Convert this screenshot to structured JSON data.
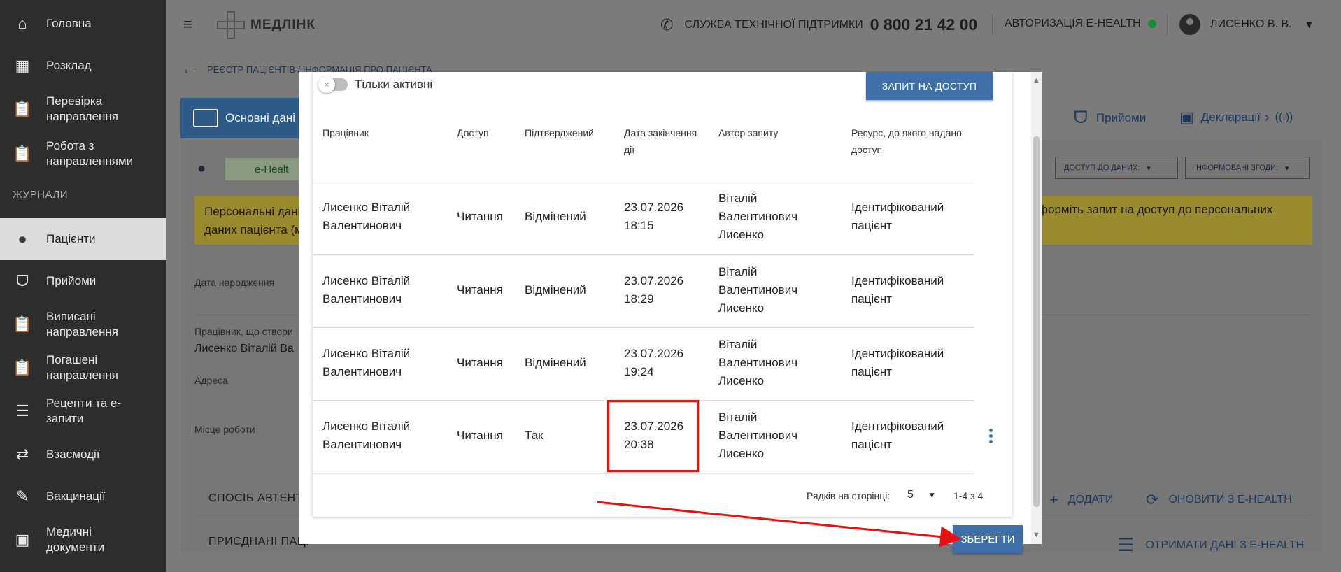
{
  "sidebar": {
    "items": [
      {
        "label": "Головна",
        "icon": "home-icon"
      },
      {
        "label": "Розклад",
        "icon": "calendar-icon"
      },
      {
        "label": "Перевірка направлення",
        "icon": "clipboard-icon"
      },
      {
        "label": "Робота з направленнями",
        "icon": "clipboard-icon"
      },
      {
        "label": "Пацієнти",
        "icon": "person-icon"
      },
      {
        "label": "Прийоми",
        "icon": "stethoscope-icon"
      },
      {
        "label": "Виписані направлення",
        "icon": "clipboard-icon"
      },
      {
        "label": "Погашені направлення",
        "icon": "clipboard-icon"
      },
      {
        "label": "Рецепти та е-запити",
        "icon": "list-icon"
      },
      {
        "label": "Взаємодії",
        "icon": "swap-icon"
      },
      {
        "label": "Вакцинації",
        "icon": "syringe-icon"
      },
      {
        "label": "Медичні документи",
        "icon": "document-plus-icon"
      }
    ],
    "section_label": "ЖУРНАЛИ",
    "active_item": "Пацієнти"
  },
  "header": {
    "logo_text": "МЕДЛІНК",
    "support_label": "СЛУЖБА ТЕХНІЧНОЇ ПІДТРИМКИ",
    "support_phone": "0 800 21 42 00",
    "ehealth_label": "АВТОРИЗАЦІЯ E-HEALTH",
    "ehealth_status_color": "#1b8a3a",
    "user_name": "ЛИСЕНКО В. В."
  },
  "page": {
    "breadcrumb": "РЕЄСТР ПАЦІЄНТІВ / ІНФОРМАЦІЯ ПРО ПАЦІЄНТА",
    "tab_main": "Основні дані",
    "tab_visits": "Прийоми",
    "tab_declarations": "Декларації",
    "ehealth_chip": "e-Healt",
    "dropdown_access": "ДОСТУП ДО ДАНИХ:",
    "dropdown_consents": "ІНФОРМОВАНІ ЗГОДИ:",
    "warning_left": "Персональні дані",
    "warning_left2": "даних пацієнта (м",
    "warning_right": "форміть запит на доступ до персональних",
    "label_birth": "Дата народження",
    "label_creator": "Працівник, що створи",
    "value_creator": "Лисенко Віталій Ва",
    "label_address": "Адреса",
    "label_work": "Місце роботи",
    "section_auth": "СПОСІБ АВТЕНТИ",
    "section_linked": "ПРИЄДНАНІ ПАЦІ",
    "action_add": "ДОДАТИ",
    "action_refresh": "ОНОВИТИ З E-HEALTH",
    "action_get": "ОТРИМАТИ ДАНІ З E-HEALTH"
  },
  "modal": {
    "toggle_label": "Тільки активні",
    "request_button": "ЗАПИТ НА ДОСТУП",
    "columns": [
      "Працівник",
      "Доступ",
      "Підтверджений",
      "Дата закінчення дії",
      "Автор запиту",
      "Ресурс, до якого надано доступ"
    ],
    "rows": [
      {
        "worker": "Лисенко Віталій Валентинович",
        "access": "Читання",
        "confirmed": "Відмінений",
        "date": "23.07.2026",
        "time": "18:15",
        "author": "Віталій Валентинович Лисенко",
        "resource": "Ідентифікований пацієнт"
      },
      {
        "worker": "Лисенко Віталій Валентинович",
        "access": "Читання",
        "confirmed": "Відмінений",
        "date": "23.07.2026",
        "time": "18:29",
        "author": "Віталій Валентинович Лисенко",
        "resource": "Ідентифікований пацієнт"
      },
      {
        "worker": "Лисенко Віталій Валентинович",
        "access": "Читання",
        "confirmed": "Відмінений",
        "date": "23.07.2026",
        "time": "19:24",
        "author": "Віталій Валентинович Лисенко",
        "resource": "Ідентифікований пацієнт"
      },
      {
        "worker": "Лисенко Віталій Валентинович",
        "access": "Читання",
        "confirmed": "Так",
        "date": "23.07.2026",
        "time": "20:38",
        "author": "Віталій Валентинович Лисенко",
        "resource": "Ідентифікований пацієнт"
      }
    ],
    "rows_per_page_label": "Рядків на сторінці:",
    "rows_per_page": "5",
    "range_label": "1-4 з 4",
    "save_button": "ЗБЕРЕГТИ"
  },
  "annotation_color": "#e81111"
}
